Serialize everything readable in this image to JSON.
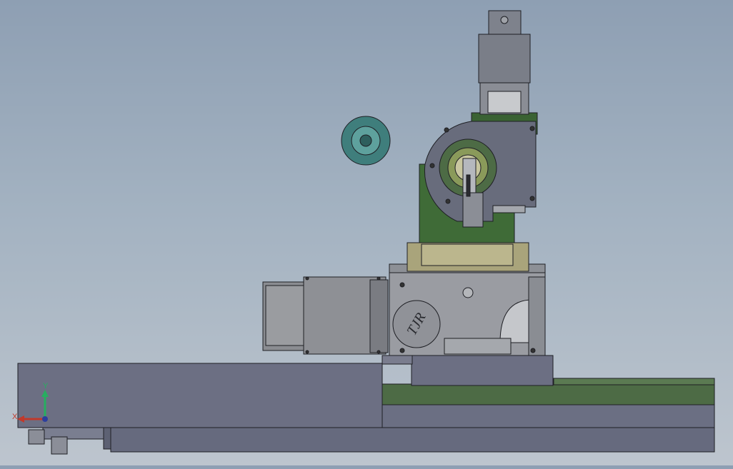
{
  "viewport": {
    "background_top": "#8e9fb3",
    "background_bottom": "#bdc5ce"
  },
  "triad": {
    "x_label": "X",
    "y_label": "Y",
    "x_color": "#c0392b",
    "y_color": "#27ae60",
    "z_color": "#2c3e9e"
  },
  "gearbox": {
    "logo_text": "TJR"
  },
  "colors": {
    "steel": "#7c8089",
    "steel_dark": "#5e636e",
    "steel_light": "#a7aab0",
    "green": "#3f6b37",
    "green_dark": "#2e5229",
    "olive": "#a9a47b",
    "teal": "#3f7e7c",
    "rail": "#6b6f83"
  }
}
